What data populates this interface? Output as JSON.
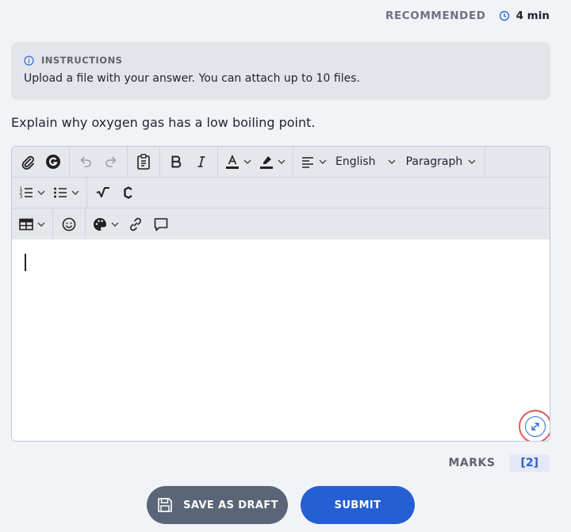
{
  "header": {
    "recommended_label": "RECOMMENDED",
    "time": "4 min"
  },
  "instructions": {
    "title": "INSTRUCTIONS",
    "text": "Upload a file with your answer. You can attach up to 10 files."
  },
  "question": "Explain why oxygen gas has a low boiling point.",
  "toolbar": {
    "language": "English",
    "block_format": "Paragraph",
    "icons": [
      "attach-icon",
      "grammarly-icon",
      "undo-icon",
      "redo-icon",
      "paste-icon",
      "bold-icon",
      "italic-icon",
      "font-color-icon",
      "highlight-icon",
      "align-icon",
      "numbered-list-icon",
      "bulleted-list-icon",
      "math-icon",
      "chemistry-icon",
      "table-icon",
      "emoji-icon",
      "palette-icon",
      "link-icon",
      "comment-icon"
    ]
  },
  "marks": {
    "label": "MARKS",
    "value": "[2]"
  },
  "buttons": {
    "save_draft": "SAVE AS DRAFT",
    "submit": "SUBMIT"
  },
  "colors": {
    "primary": "#2460d3",
    "secondary": "#5a6677",
    "highlight_ring": "#e05a5a"
  }
}
